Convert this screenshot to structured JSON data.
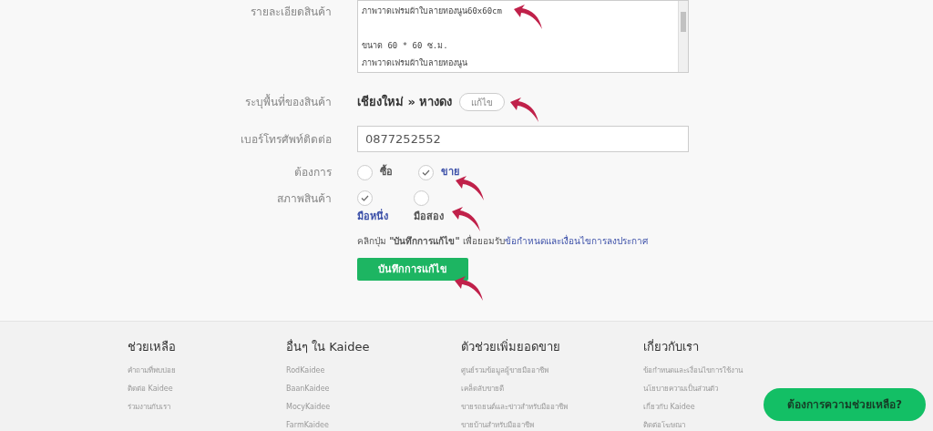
{
  "form": {
    "description": {
      "label": "รายละเอียดสินค้า",
      "lines": [
        "ภาพวาดเฟรมผ้าใบลายทองนูน60x60cm",
        "ขนาด 60 * 60 ซ.ม.",
        "ภาพวาดเฟรมผ้าใบลายทองนูน"
      ]
    },
    "location": {
      "label": "ระบุพื้นที่ของสินค้า",
      "value": "เชียงใหม่ » หางดง",
      "edit_button": "แก้ไข"
    },
    "phone": {
      "label": "เบอร์โทรศัพท์ติดต่อ",
      "value": "0877252552"
    },
    "want": {
      "label": "ต้องการ",
      "options": [
        {
          "label": "ซื้อ",
          "selected": false
        },
        {
          "label": "ขาย",
          "selected": true
        }
      ]
    },
    "condition": {
      "label": "สภาพสินค้า",
      "options": [
        {
          "label": "มือหนึ่ง",
          "selected": true
        },
        {
          "label": "มือสอง",
          "selected": false
        }
      ]
    },
    "terms_note": "คลิกปุ่ม **\"บันทึกการแก้ไข\"** เพื่อยอมรับ",
    "terms_link": "ข้อกำหนดและเงื่อนไขการลงประกาศ",
    "save_button": "บันทึกการแก้ไข"
  },
  "footer": {
    "columns": [
      {
        "title": "ช่วยเหลือ",
        "links": [
          "คำถามที่พบบ่อย",
          "ติดต่อ Kaidee",
          "ร่วมงานกับเรา"
        ]
      },
      {
        "title": "อื่นๆ ใน Kaidee",
        "links": [
          "RodKaidee",
          "BaanKaidee",
          "MocyKaidee",
          "FarmKaidee"
        ]
      },
      {
        "title": "ตัวช่วยเพิ่มยอดขาย",
        "links": [
          "ศูนย์รวมข้อมูลผู้ขายมืออาชีพ",
          "เคล็ดลับขายดี",
          "ขายรถยนต์และข่าวสำหรับมืออาชีพ",
          "ขายบ้านสำหรับมืออาชีพ"
        ]
      },
      {
        "title": "เกี่ยวกับเรา",
        "links": [
          "ข้อกำหนดและเงื่อนไขการใช้งาน",
          "นโยบายความเป็นส่วนตัว",
          "เกี่ยวกับ Kaidee",
          "ติดต่อโฆษณา"
        ]
      }
    ],
    "help_button": "ต้องการความช่วยเหลือ?"
  }
}
